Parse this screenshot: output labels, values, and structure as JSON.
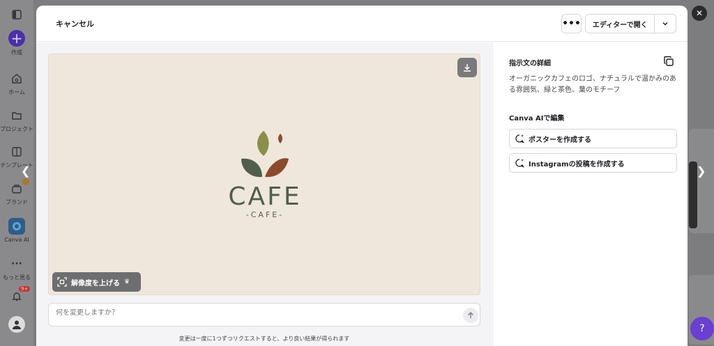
{
  "sidebar": {
    "items": [
      {
        "label": "作成"
      },
      {
        "label": "ホーム"
      },
      {
        "label": "プロジェクト"
      },
      {
        "label": "テンプレート"
      },
      {
        "label": "ブランド"
      },
      {
        "label": "Canva AI"
      },
      {
        "label": "もっと見る"
      }
    ],
    "notification_count": "9+"
  },
  "header": {
    "cancel_label": "キャンセル",
    "more_label": "•••",
    "open_editor_label": "エディターで開く"
  },
  "preview": {
    "logo_main_text": "CAFE",
    "logo_sub_text": "-CAFE-",
    "upscale_label": "解像度を上げる",
    "colors": {
      "olive": "#8a8f4a",
      "green": "#4f5f4c",
      "brown": "#8b4a2b",
      "bg": "#efe7dc"
    }
  },
  "input": {
    "placeholder": "何を変更しますか？",
    "hint": "変更は一度に1つずつリクエストすると、より良い結果が得られます"
  },
  "details": {
    "title": "指示文の詳細",
    "prompt": "オーガニックカフェのロゴ、ナチュラルで温かみのある雰囲気、緑と茶色、葉のモチーフ",
    "edit_title": "Canva AIで編集",
    "actions": [
      {
        "label": "ポスターを作成する"
      },
      {
        "label": "Instagramの投稿を作成する"
      }
    ]
  }
}
